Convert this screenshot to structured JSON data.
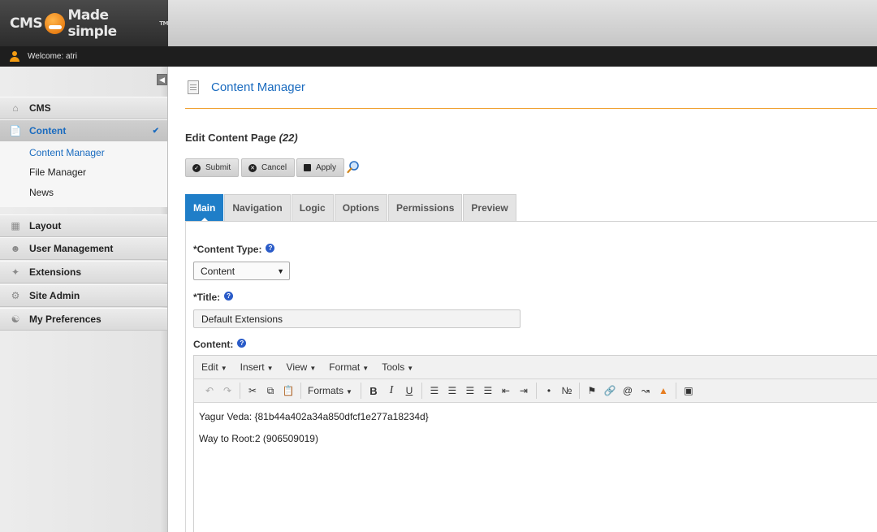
{
  "header": {
    "logo_left": "CMS",
    "logo_right": "Made simple",
    "logo_tm": "TM"
  },
  "userbar": {
    "welcome": "Welcome: atri"
  },
  "sidebar": {
    "sections": [
      {
        "label": "CMS",
        "icon": "home-icon"
      },
      {
        "label": "Content",
        "icon": "content-icon",
        "active": true
      },
      {
        "label": "Layout",
        "icon": "layout-icon"
      },
      {
        "label": "User Management",
        "icon": "users-icon"
      },
      {
        "label": "Extensions",
        "icon": "extensions-icon"
      },
      {
        "label": "Site Admin",
        "icon": "site-admin-icon"
      },
      {
        "label": "My Preferences",
        "icon": "preferences-icon"
      }
    ],
    "content_items": [
      {
        "label": "Content Manager",
        "active": true
      },
      {
        "label": "File Manager"
      },
      {
        "label": "News"
      }
    ]
  },
  "main": {
    "page_title": "Content Manager",
    "edit_heading": "Edit Content Page",
    "edit_id": "(22)",
    "buttons": {
      "submit": "Submit",
      "cancel": "Cancel",
      "apply": "Apply"
    },
    "tabs": [
      "Main",
      "Navigation",
      "Logic",
      "Options",
      "Permissions",
      "Preview"
    ],
    "active_tab": "Main",
    "content_type_label": "*Content Type:",
    "content_type_value": "Content",
    "title_label": "*Title:",
    "title_value": "Default Extensions",
    "content_label": "Content:",
    "help_glyph": "?"
  },
  "editor": {
    "menus": [
      "Edit",
      "Insert",
      "View",
      "Format",
      "Tools"
    ],
    "formats_label": "Formats",
    "lines": [
      "Yagur Veda: {81b44a402a34a850dfcf1e277a18234d}",
      "Way to Root:2 (906509019)"
    ]
  },
  "colors": {
    "accent": "#1a6bbf",
    "active_tab": "#1f7ec8",
    "rule": "#f0a030"
  }
}
